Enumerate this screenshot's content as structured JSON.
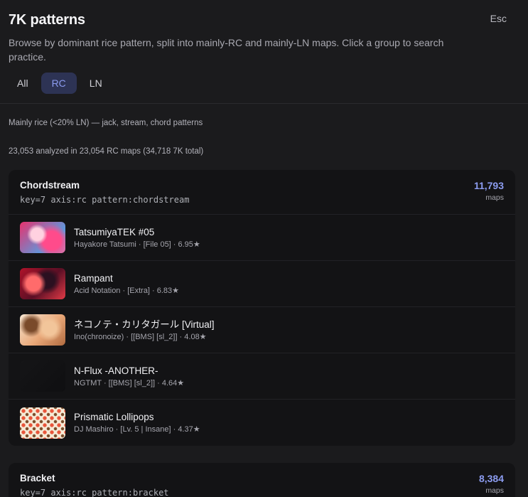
{
  "header": {
    "title": "7K patterns",
    "close_label": "Esc",
    "subtitle": "Browse by dominant rice pattern, split into mainly-RC and mainly-LN maps. Click a group to search practice."
  },
  "tabs": [
    {
      "label": "All",
      "active": false
    },
    {
      "label": "RC",
      "active": true
    },
    {
      "label": "LN",
      "active": false
    }
  ],
  "section": {
    "description": "Mainly rice (<20% LN) — jack, stream, chord patterns",
    "analyzed": "23,053 analyzed in 23,054 RC maps (34,718 7K total)"
  },
  "groups": [
    {
      "name": "Chordstream",
      "query": "key=7 axis:rc pattern:chordstream",
      "count": "11,793",
      "count_unit": "maps",
      "maps": [
        {
          "title": "TatsumiyaTEK #05",
          "detail": "Hayakore Tatsumi · [File 05] · 6.95★"
        },
        {
          "title": "Rampant",
          "detail": "Acid Notation · [Extra] · 6.83★"
        },
        {
          "title": "ネコノテ・カリタガール [Virtual]",
          "detail": "Ino(chronoize) · [[BMS] [sl_2]] · 4.08★"
        },
        {
          "title": "N-Flux -ANOTHER-",
          "detail": "NGTMT · [[BMS] [sl_2]] · 4.64★"
        },
        {
          "title": "Prismatic Lollipops",
          "detail": "DJ Mashiro · [Lv. 5 | Insane] · 4.37★"
        }
      ]
    },
    {
      "name": "Bracket",
      "query": "key=7 axis:rc pattern:bracket",
      "count": "8,384",
      "count_unit": "maps"
    }
  ],
  "colors": {
    "background": "#1b1b1d",
    "card": "#131315",
    "accent": "#8c9cf0",
    "active_tab_bg": "#2d3354"
  }
}
